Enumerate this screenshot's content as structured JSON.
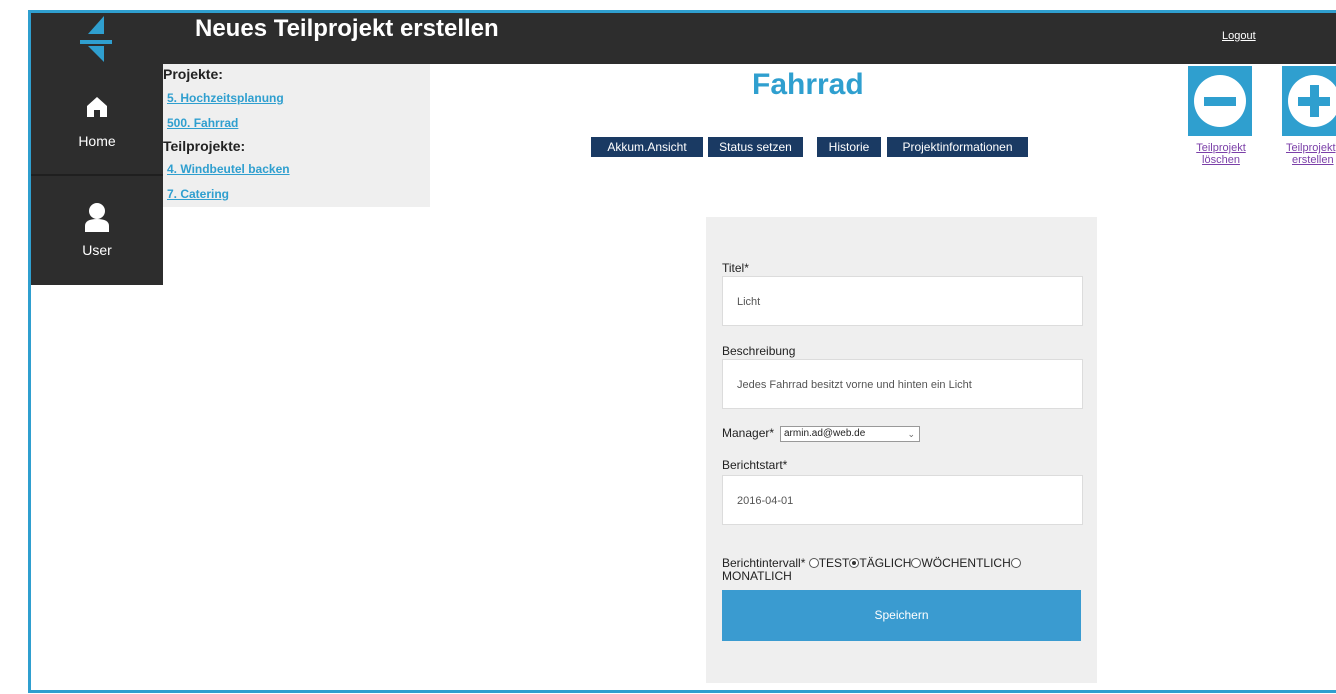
{
  "header": {
    "title": "Neues Teilprojekt erstellen",
    "logout_label": "Logout"
  },
  "sidebar": {
    "items": [
      {
        "label": "Home",
        "icon": "home-icon"
      },
      {
        "label": "User",
        "icon": "user-icon"
      }
    ]
  },
  "tree": {
    "projects_heading": "Projekte:",
    "projects": [
      "5. Hochzeitsplanung",
      "500. Fahrrad"
    ],
    "subprojects_heading": "Teilprojekte:",
    "subprojects": [
      "4. Windbeutel backen",
      "7. Catering"
    ]
  },
  "main": {
    "project_name": "Fahrrad",
    "tabs": [
      "Akkum.Ansicht",
      "Status setzen",
      "Historie",
      "Projektinformationen"
    ]
  },
  "actions": {
    "delete_label_1": "Teilprojekt",
    "delete_label_2": "löschen",
    "create_label_1": "Teilprojekt",
    "create_label_2": "erstellen"
  },
  "form": {
    "title_label": "Titel*",
    "title_value": "Licht",
    "description_label": "Beschreibung",
    "description_value": "Jedes Fahrrad besitzt vorne und hinten ein Licht",
    "manager_label": "Manager*",
    "manager_value": "armin.ad@web.de",
    "report_start_label": "Berichtstart*",
    "report_start_value": "2016-04-01",
    "interval_label": "Berichtintervall*",
    "interval_options": [
      "TEST",
      "TÄGLICH",
      "WÖCHENTLICH",
      "MONATLICH"
    ],
    "interval_selected": "TÄGLICH",
    "save_label": "Speichern"
  },
  "colors": {
    "accent": "#2f9fcf",
    "dark": "#2d2d2d",
    "tab": "#1a3a63",
    "button": "#3a9bd0"
  }
}
